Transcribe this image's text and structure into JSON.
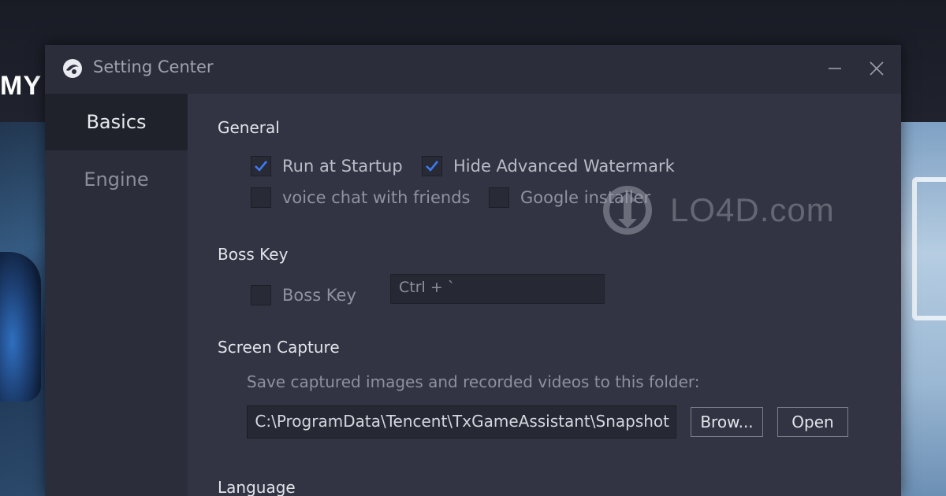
{
  "background": {
    "partial_title": "MY"
  },
  "window": {
    "title": "Setting Center",
    "logo_icon": "app-logo-icon",
    "minimize_icon": "minimize-icon",
    "close_icon": "close-icon"
  },
  "sidebar": {
    "items": [
      {
        "label": "Basics",
        "active": true
      },
      {
        "label": "Engine",
        "active": false
      }
    ]
  },
  "general": {
    "title": "General",
    "options": [
      {
        "label": "Run at Startup",
        "checked": true
      },
      {
        "label": "Hide Advanced Watermark",
        "checked": true
      },
      {
        "label": "voice chat with friends",
        "checked": false
      },
      {
        "label": "Google installer",
        "checked": false
      }
    ]
  },
  "boss_key": {
    "title": "Boss Key",
    "checkbox_label": "Boss Key",
    "checked": false,
    "shortcut": "Ctrl + `"
  },
  "screen_capture": {
    "title": "Screen Capture",
    "description": "Save captured images and recorded videos to this folder:",
    "path": "C:\\ProgramData\\Tencent\\TxGameAssistant\\Snapshot",
    "browse_label": "Brow...",
    "open_label": "Open"
  },
  "language": {
    "title": "Language"
  },
  "watermark": {
    "text": "LO4D.com"
  },
  "colors": {
    "checkbox_check": "#3e7bf0",
    "window_bg": "#2b2d3a",
    "content_bg": "#323443"
  }
}
